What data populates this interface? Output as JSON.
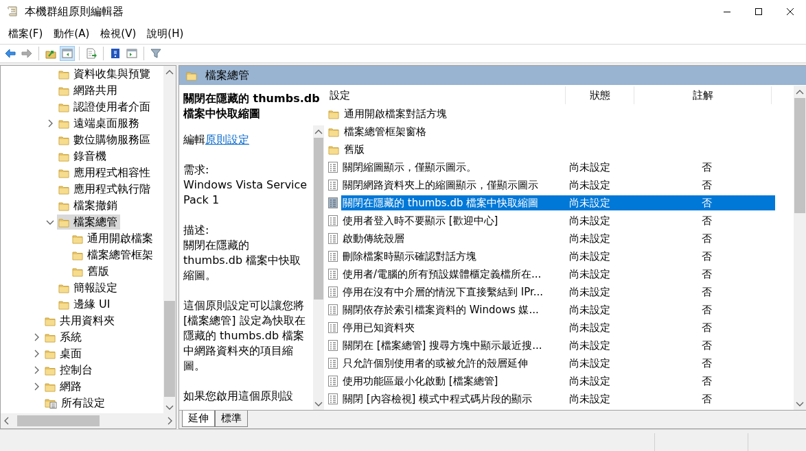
{
  "window": {
    "title": "本機群組原則編輯器"
  },
  "menu": [
    "檔案(F)",
    "動作(A)",
    "檢視(V)",
    "說明(H)"
  ],
  "toolbar": [
    {
      "kind": "back",
      "pressed": false,
      "disabled": false
    },
    {
      "kind": "forward",
      "pressed": false,
      "disabled": true
    },
    {
      "kind": "separator"
    },
    {
      "kind": "up",
      "pressed": false,
      "disabled": false
    },
    {
      "kind": "tree-toggle",
      "pressed": true,
      "disabled": false
    },
    {
      "kind": "separator"
    },
    {
      "kind": "export",
      "pressed": false,
      "disabled": false
    },
    {
      "kind": "separator"
    },
    {
      "kind": "help",
      "pressed": false,
      "disabled": false
    },
    {
      "kind": "pane-toggle",
      "pressed": false,
      "disabled": false
    },
    {
      "kind": "separator"
    },
    {
      "kind": "filter",
      "pressed": false,
      "disabled": false
    }
  ],
  "tree": {
    "partial_group": {
      "children": [
        {
          "label": "資料收集與預覽",
          "kind": "folder",
          "selected": false
        },
        {
          "label": "網路共用",
          "kind": "folder",
          "selected": false
        },
        {
          "label": "認證使用者介面",
          "kind": "folder",
          "selected": false
        },
        {
          "label": "遠端桌面服務",
          "kind": "folder",
          "expanded": false,
          "selected": false
        },
        {
          "label": "數位購物服務區",
          "kind": "folder",
          "selected": false
        },
        {
          "label": "錄音機",
          "kind": "folder",
          "selected": false
        },
        {
          "label": "應用程式相容性",
          "kind": "folder",
          "selected": false
        },
        {
          "label": "應用程式執行階",
          "kind": "folder",
          "selected": false
        },
        {
          "label": "檔案撤銷",
          "kind": "folder",
          "selected": false
        },
        {
          "label": "檔案總管",
          "kind": "folder",
          "expanded": true,
          "selected": true,
          "children": [
            {
              "label": "通用開啟檔案",
              "kind": "folder",
              "selected": false
            },
            {
              "label": "檔案總管框架",
              "kind": "folder",
              "selected": false
            },
            {
              "label": "舊版",
              "kind": "folder",
              "selected": false
            }
          ]
        },
        {
          "label": "簡報設定",
          "kind": "folder",
          "selected": false
        },
        {
          "label": "邊緣 UI",
          "kind": "folder",
          "selected": false
        }
      ]
    },
    "items": [
      {
        "label": "共用資料夾",
        "kind": "folder",
        "selected": false
      },
      {
        "label": "系統",
        "kind": "folder",
        "expanded": false,
        "selected": false
      },
      {
        "label": "桌面",
        "kind": "folder",
        "expanded": false,
        "selected": false
      },
      {
        "label": "控制台",
        "kind": "folder",
        "expanded": false,
        "selected": false
      },
      {
        "label": "網路",
        "kind": "folder",
        "expanded": false,
        "selected": false
      },
      {
        "label": "所有設定",
        "kind": "settings",
        "selected": false
      }
    ]
  },
  "details": {
    "header": "檔案總管",
    "title": "關閉在隱藏的 thumbs.db 檔案中快取縮圖",
    "edit_label": "編輯",
    "edit_link": "原則設定",
    "requirement_label": "需求:",
    "requirement": "Windows Vista Service Pack 1",
    "description_label": "描述:",
    "paragraphs": [
      "關閉在隱藏的 thumbs.db 檔案中快取縮圖。",
      "這個原則設定可以讓您將 [檔案總管] 設定為快取在隱藏的 thumbs.db 檔案中網路資料夾的項目縮圖。",
      "如果您啟用這個原則設"
    ]
  },
  "tabs": [
    {
      "label": "延伸",
      "selected": true
    },
    {
      "label": "標準",
      "selected": false
    }
  ],
  "list": {
    "columns": [
      "設定",
      "狀態",
      "註解"
    ],
    "rows": [
      {
        "kind": "folder",
        "name": "通用開啟檔案對話方塊",
        "selected": false
      },
      {
        "kind": "folder",
        "name": "檔案總管框架窗格",
        "selected": false
      },
      {
        "kind": "folder",
        "name": "舊版",
        "selected": false
      },
      {
        "kind": "setting",
        "name": "關閉縮圖顯示，僅顯示圖示。",
        "state": "尚未設定",
        "comment": "否",
        "selected": false
      },
      {
        "kind": "setting",
        "name": "關閉網路資料夾上的縮圖顯示，僅顯示圖示",
        "state": "尚未設定",
        "comment": "否",
        "selected": false
      },
      {
        "kind": "setting",
        "name": "關閉在隱藏的 thumbs.db 檔案中快取縮圖",
        "state": "尚未設定",
        "comment": "否",
        "selected": true
      },
      {
        "kind": "setting",
        "name": "使用者登入時不要顯示 [歡迎中心]",
        "state": "尚未設定",
        "comment": "否",
        "selected": false
      },
      {
        "kind": "setting",
        "name": "啟動傳統殼層",
        "state": "尚未設定",
        "comment": "否",
        "selected": false
      },
      {
        "kind": "setting",
        "name": "刪除檔案時顯示確認對話方塊",
        "state": "尚未設定",
        "comment": "否",
        "selected": false
      },
      {
        "kind": "setting",
        "name": "使用者/電腦的所有預設媒體櫃定義檔所在...",
        "state": "尚未設定",
        "comment": "否",
        "selected": false
      },
      {
        "kind": "setting",
        "name": "停用在沒有中介層的情況下直接繫結到 IPr...",
        "state": "尚未設定",
        "comment": "否",
        "selected": false
      },
      {
        "kind": "setting",
        "name": "關閉依存於索引檔案資料的 Windows 媒...",
        "state": "尚未設定",
        "comment": "否",
        "selected": false
      },
      {
        "kind": "setting",
        "name": "停用已知資料夾",
        "state": "尚未設定",
        "comment": "否",
        "selected": false
      },
      {
        "kind": "setting",
        "name": "關閉在 [檔案總管] 搜尋方塊中顯示最近搜...",
        "state": "尚未設定",
        "comment": "否",
        "selected": false
      },
      {
        "kind": "setting",
        "name": "只允許個別使用者的或被允許的殼層延伸",
        "state": "尚未設定",
        "comment": "否",
        "selected": false
      },
      {
        "kind": "setting",
        "name": "使用功能區最小化啟動 [檔案總管]",
        "state": "尚未設定",
        "comment": "否",
        "selected": false
      },
      {
        "kind": "setting",
        "name": "關閉 [內容檢視] 模式中程式碼片段的顯示",
        "state": "尚未設定",
        "comment": "否",
        "selected": false
      }
    ]
  }
}
